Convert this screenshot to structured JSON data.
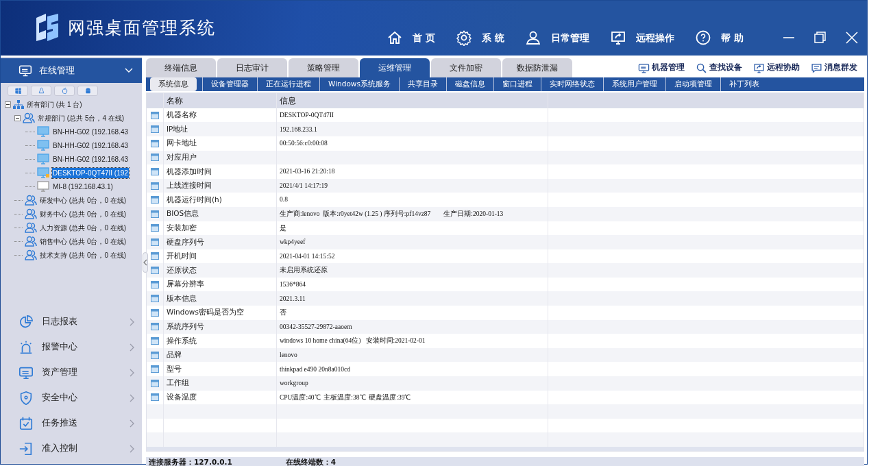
{
  "app": {
    "title": "网强桌面管理系统"
  },
  "top_nav": [
    {
      "label": "首 页"
    },
    {
      "label": "系 统"
    },
    {
      "label": "日常管理"
    },
    {
      "label": "远程操作"
    },
    {
      "label": "帮 助"
    }
  ],
  "sidebar": {
    "section": {
      "label": "在线管理",
      "expanded": true
    },
    "tree": [
      {
        "label": "所有部门 (共 1 台)",
        "kind": "root",
        "expanded": true,
        "children": [
          {
            "label": "常规部门 (总共 5台，4 在线)",
            "kind": "group",
            "expanded": true,
            "children": [
              {
                "label": "BN-HH-G02 (192.168.43",
                "kind": "machine",
                "online": true,
                "locked": false,
                "selected": false
              },
              {
                "label": "BN-HH-G02 (192.168.43",
                "kind": "machine",
                "online": true,
                "locked": false,
                "selected": false
              },
              {
                "label": "BN-HH-G02 (192.168.43",
                "kind": "machine",
                "online": true,
                "locked": false,
                "selected": false
              },
              {
                "label": "DESKTOP-0QT47II (192",
                "kind": "machine",
                "online": true,
                "locked": true,
                "selected": true
              },
              {
                "label": "MI-8 (192.168.43.1)",
                "kind": "machine",
                "online": false,
                "locked": false,
                "selected": false
              }
            ]
          },
          {
            "label": "研发中心 (总共 0台，0 在线)",
            "kind": "group"
          },
          {
            "label": "财务中心 (总共 0台，0 在线)",
            "kind": "group"
          },
          {
            "label": "人力资源 (总共 0台，0 在线)",
            "kind": "group"
          },
          {
            "label": "销售中心 (总共 0台，0 在线)",
            "kind": "group"
          },
          {
            "label": "技术支持 (总共 0台，0 在线)",
            "kind": "group"
          }
        ]
      }
    ],
    "menu": [
      {
        "label": "日志报表"
      },
      {
        "label": "报警中心"
      },
      {
        "label": "资产管理"
      },
      {
        "label": "安全中心"
      },
      {
        "label": "任务推送"
      },
      {
        "label": "准入控制"
      }
    ]
  },
  "tabs": [
    {
      "label": "终端信息",
      "selected": false
    },
    {
      "label": "日志审计",
      "selected": false
    },
    {
      "label": "策略管理",
      "selected": false
    },
    {
      "label": "运维管理",
      "selected": true
    },
    {
      "label": "文件加密",
      "selected": false
    },
    {
      "label": "数据防泄漏",
      "selected": false
    }
  ],
  "actions": [
    {
      "label": "机器管理"
    },
    {
      "label": "查找设备"
    },
    {
      "label": "远程协助"
    },
    {
      "label": "消息群发"
    }
  ],
  "subtabs": [
    {
      "label": "系统信息",
      "selected": true
    },
    {
      "label": "设备管理器",
      "selected": false
    },
    {
      "label": "正在运行进程",
      "selected": false
    },
    {
      "label": "Windows系统服务",
      "selected": false
    },
    {
      "label": "共享目录",
      "selected": false
    },
    {
      "label": "磁盘信息",
      "selected": false
    },
    {
      "label": "窗口进程",
      "selected": false
    },
    {
      "label": "实时网络状态",
      "selected": false
    },
    {
      "label": "系统用户管理",
      "selected": false
    },
    {
      "label": "启动项管理",
      "selected": false
    },
    {
      "label": "补丁列表",
      "selected": false
    }
  ],
  "table": {
    "columns": [
      "名称",
      "信息"
    ],
    "rows": [
      [
        "机器名称",
        "DESKTOP-0QT47II"
      ],
      [
        "IP地址",
        "192.168.233.1"
      ],
      [
        "网卡地址",
        "00:50:56:c0:00:08"
      ],
      [
        "对应用户",
        ""
      ],
      [
        "机器添加时间",
        "2021-03-16 21:20:18"
      ],
      [
        "上线连接时间",
        "2021/4/1 14:17:19"
      ],
      [
        "机器运行时间(h)",
        "0.8"
      ],
      [
        "BIOS信息",
        "生产商:lenovo  版本:r0yet42w (1.25 ) 序列号:pf14vz87        生产日期:2020-01-13"
      ],
      [
        "安装加密",
        "是"
      ],
      [
        "硬盘序列号",
        "wkp4yeef"
      ],
      [
        "开机时间",
        "2021-04-01 14:15:52"
      ],
      [
        "还原状态",
        "未启用系统还原"
      ],
      [
        "屏幕分辨率",
        "1536*864"
      ],
      [
        "版本信息",
        "2021.3.11"
      ],
      [
        "Windows密码是否为空",
        "否"
      ],
      [
        "系统序列号",
        "00342-35527-29872-aaoem"
      ],
      [
        "操作系统",
        "windows 10 home china(64位)   安装时间:2021-02-01"
      ],
      [
        "品牌",
        "lenovo"
      ],
      [
        "型号",
        "thinkpad e490 20n8a010cd"
      ],
      [
        "工作组",
        "workgroup"
      ],
      [
        "设备温度",
        "CPU温度:40℃  主板温度:38℃  硬盘温度:39℃"
      ]
    ]
  },
  "status_bar": [
    "连接服务器：127.0.0.1",
    "在线终端数：4"
  ]
}
